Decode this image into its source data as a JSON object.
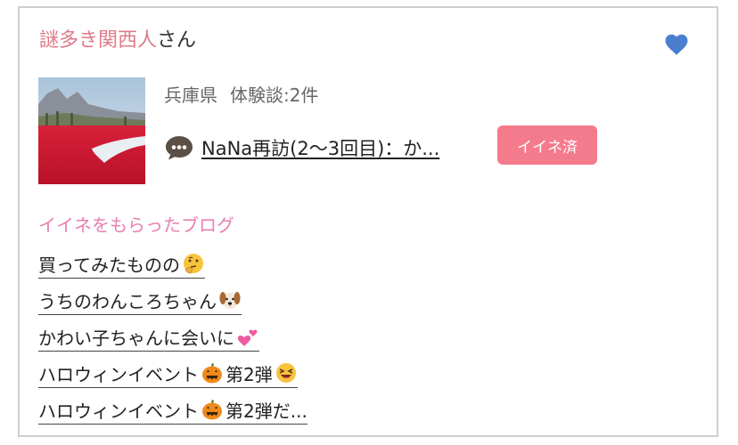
{
  "user": {
    "name": "謎多き関西人",
    "suffix": "さん"
  },
  "profile": {
    "location": "兵庫県",
    "stories_label": "体験談:2件"
  },
  "story": {
    "title": "NaNa再訪(2〜3回目)：か...",
    "badge": "イイネ済"
  },
  "liked_blogs": {
    "title": "イイネをもらったブログ",
    "items": [
      {
        "text": "買ってみたものの",
        "emoji": "thinking-face",
        "text2": ""
      },
      {
        "text": "うちのわんころちゃん",
        "emoji": "dog-face",
        "text2": ""
      },
      {
        "text": "かわい子ちゃんに会いに",
        "emoji": "two-hearts",
        "text2": ""
      },
      {
        "text": "ハロウィンイベント",
        "emoji": "jack-o-lantern",
        "text2": "第2弾",
        "emoji2": "laughing-face"
      },
      {
        "text": "ハロウィンイベント",
        "emoji": "jack-o-lantern",
        "text2": "第2弾だ..."
      }
    ]
  },
  "colors": {
    "username": "#e07a8a",
    "heart": "#4a7fcf",
    "badge": "#f47b8c",
    "section_title": "#e97fb0"
  }
}
